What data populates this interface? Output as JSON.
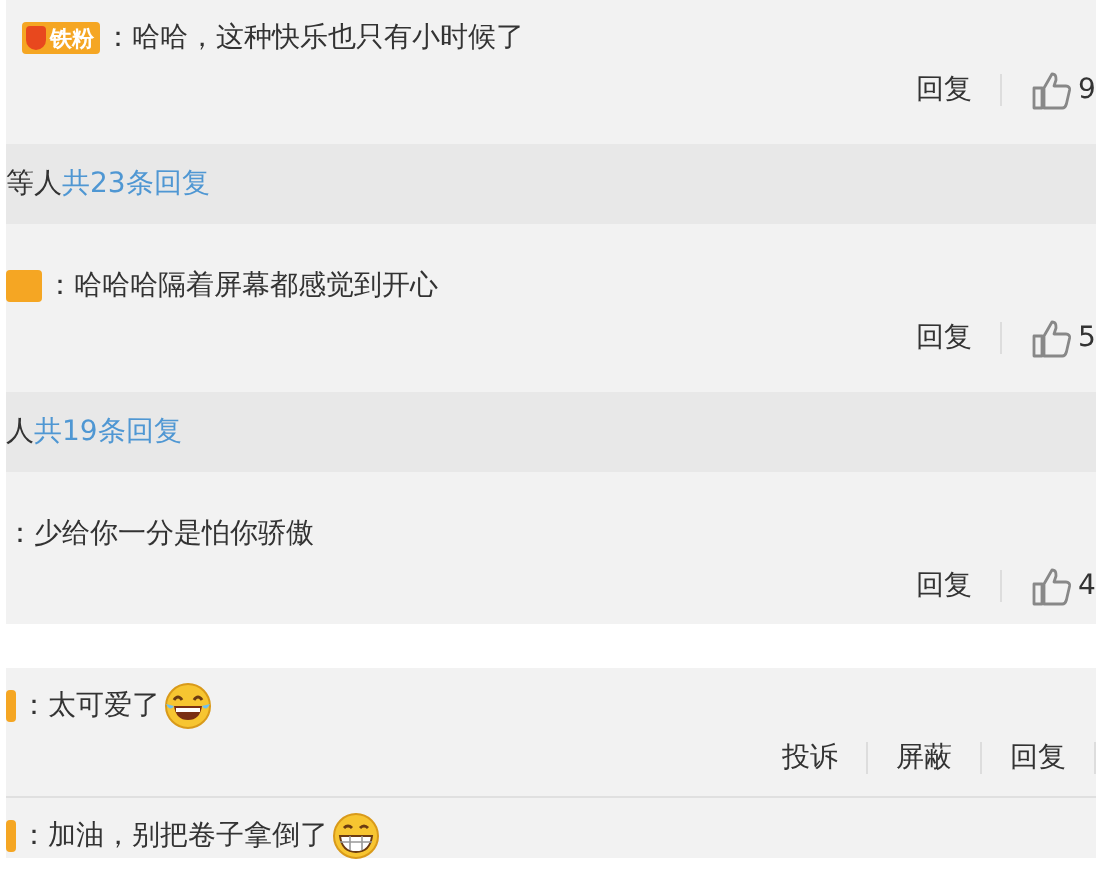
{
  "groups": [
    {
      "comments": [
        {
          "badge": {
            "kind": "full",
            "label": "铁粉"
          },
          "text": "：哈哈，这种快乐也只有小时候了",
          "actions": [
            "回复"
          ],
          "likes": "9"
        }
      ],
      "more": {
        "prefix": "等人",
        "link": "共23条回复"
      }
    },
    {
      "comments": [
        {
          "badge": {
            "kind": "cut"
          },
          "text": "：哈哈哈隔着屏幕都感觉到开心",
          "actions": [
            "回复"
          ],
          "likes": "5"
        }
      ],
      "more": {
        "prefix": "人",
        "link": "共19条回复"
      }
    },
    {
      "comments": [
        {
          "text": "：少给你一分是怕你骄傲",
          "actions": [
            "回复"
          ],
          "likes": "4"
        }
      ]
    },
    {
      "comments": [
        {
          "badge": {
            "kind": "stub"
          },
          "text": "：太可爱了",
          "emoji": {
            "kind": "laugh"
          },
          "actions": [
            "投诉",
            "屏蔽",
            "回复"
          ]
        },
        {
          "badge": {
            "kind": "stub"
          },
          "text": "：加油，别把卷子拿倒了",
          "emoji": {
            "kind": "grin"
          }
        }
      ]
    }
  ]
}
